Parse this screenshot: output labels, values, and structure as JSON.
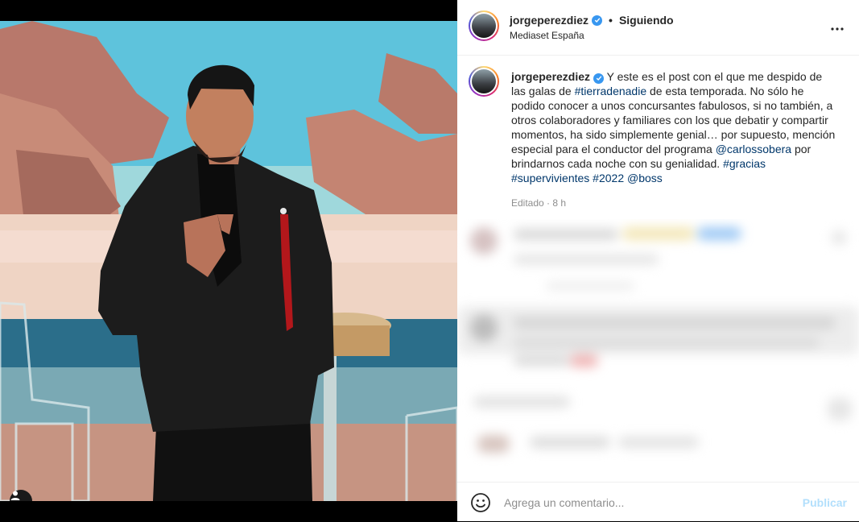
{
  "post": {
    "author": "jorgeperezdiez",
    "verified": true,
    "follow_status": "Siguiendo",
    "separator": "•",
    "location": "Mediaset España",
    "caption_segments": [
      {
        "text": "Y este es el post con el que me despido de las galas de ",
        "type": "text"
      },
      {
        "text": "#tierradenadie",
        "type": "hashtag"
      },
      {
        "text": " de esta temporada. No sólo he podido conocer a unos concursantes fabulosos, si no también, a otros colaboradores y familiares con los que debatir y compartir momentos, ha sido simplemente genial… por supuesto, mención especial para el conductor del programa ",
        "type": "text"
      },
      {
        "text": "@carlossobera",
        "type": "mention"
      },
      {
        "text": " por brindarnos cada noche con su genialidad. ",
        "type": "text"
      },
      {
        "text": "#gracias",
        "type": "hashtag"
      },
      {
        "text": " ",
        "type": "text"
      },
      {
        "text": "#supervivientes",
        "type": "hashtag"
      },
      {
        "text": " ",
        "type": "text"
      },
      {
        "text": "#2022",
        "type": "hashtag"
      },
      {
        "text": " ",
        "type": "text"
      },
      {
        "text": "@boss",
        "type": "mention"
      }
    ],
    "edited_label": "Editado",
    "time_ago": "8 h"
  },
  "comment_bar": {
    "placeholder": "Agrega un comentario...",
    "publish_label": "Publicar"
  },
  "icons": {
    "verified": "verified-badge-icon",
    "more": "more-options-icon",
    "emoji": "emoji-icon",
    "user_tag": "user-tag-icon"
  },
  "colors": {
    "link": "#00376b",
    "verified": "#3897f0",
    "publish_disabled": "#b2dffc",
    "muted": "#8e8e8e"
  }
}
